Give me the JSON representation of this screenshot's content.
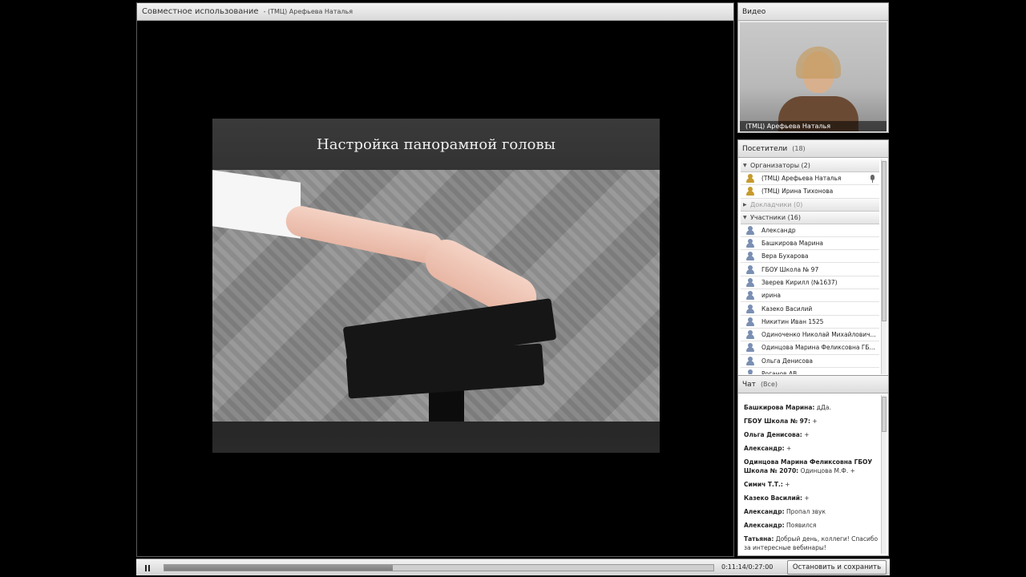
{
  "share": {
    "title": "Совместное использование",
    "presenter": "- (ТМЦ) Арефьева Наталья"
  },
  "slide": {
    "title": "Настройка панорамной головы"
  },
  "video": {
    "title": "Видео",
    "caption": "(ТМЦ) Арефьева Наталья"
  },
  "attendees": {
    "title": "Посетители",
    "count": "(18)",
    "groups": [
      {
        "label": "Организаторы (2)",
        "expanded": true,
        "members": [
          "(ТМЦ) Арефьева Наталья",
          "(ТМЦ) Ирина Тихонова"
        ]
      },
      {
        "label": "Докладчики (0)",
        "expanded": false,
        "members": []
      },
      {
        "label": "Участники (16)",
        "expanded": true,
        "members": [
          "Александр",
          "Башкирова Марина",
          "Вера Бухарова",
          "ГБОУ Школа № 97",
          "Зверев Кирилл (№1637)",
          "ирина",
          "Казеко Василий",
          "Никитин Иван 1525",
          "Одиноченко Николай Михайлович...",
          "Одинцова Марина Феликсовна ГБ...",
          "Ольга Денисова",
          "Роганов АВ"
        ]
      }
    ]
  },
  "chat": {
    "title": "Чат",
    "scope": "(Все)",
    "messages": [
      {
        "author": "Башкирова Марина:",
        "text": " дДа."
      },
      {
        "author": "ГБОУ Школа № 97:",
        "text": " +"
      },
      {
        "author": "Ольга Денисова:",
        "text": " +"
      },
      {
        "author": "Александр:",
        "text": " +"
      },
      {
        "author": "Одинцова Марина Феликсовна ГБОУ Школа № 2070:",
        "text": " Одинцова М.Ф. +"
      },
      {
        "author": "Симич Т.Т.:",
        "text": " +"
      },
      {
        "author": "Казеко Василий:",
        "text": " +"
      },
      {
        "author": "Александр:",
        "text": " Пропал звук"
      },
      {
        "author": "Александр:",
        "text": " Появился"
      },
      {
        "author": "Татьяна:",
        "text": " Добрый день, коллеги! Спасибо за интересные вебинары!"
      }
    ]
  },
  "playback": {
    "time": "0:11:14/0:27:00",
    "progress": 0.416,
    "buffered": 1.0,
    "stop_label": "Остановить и сохранить"
  }
}
